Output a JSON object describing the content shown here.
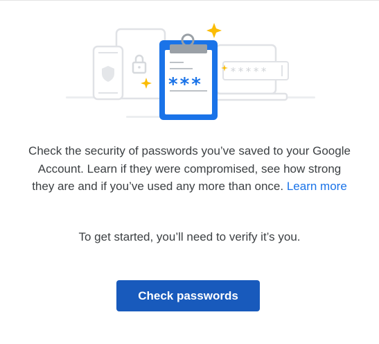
{
  "illustration": {
    "password_mask": "*****",
    "clipboard_mask": "***"
  },
  "content": {
    "description": "Check the security of passwords you’ve saved to your Google Account. Learn if they were compromised, see how strong they are and if you’ve used any more than once.",
    "learn_more": "Learn more",
    "verify_text": "To get started, you’ll need to verify it’s you."
  },
  "actions": {
    "check_passwords": "Check passwords"
  },
  "colors": {
    "accent_blue": "#1a73e8",
    "button_blue": "#185abc",
    "sparkle_yellow": "#fbbc04",
    "device_gray": "#e8eaed"
  }
}
